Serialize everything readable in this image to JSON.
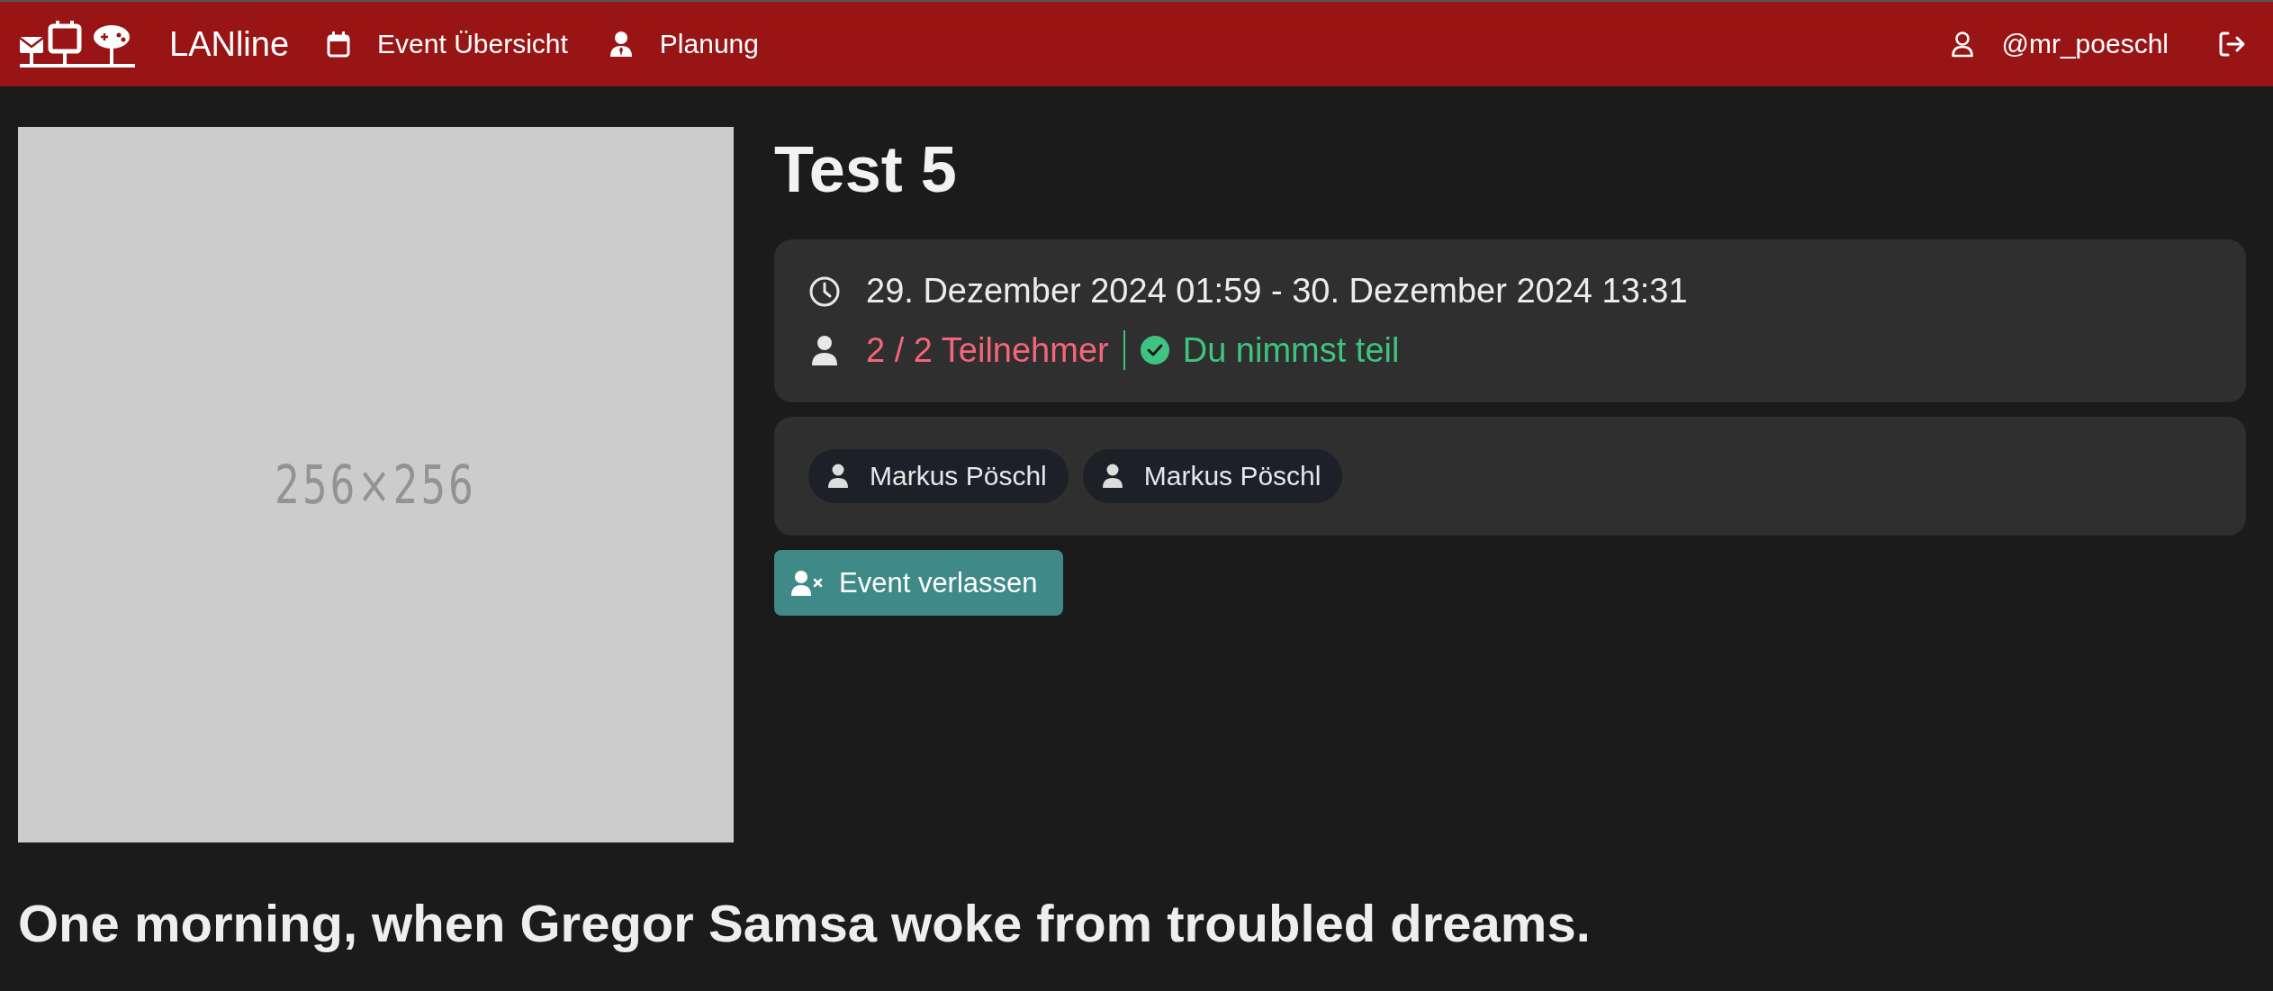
{
  "navbar": {
    "brand": "LANline",
    "links": [
      {
        "label": "Event Übersicht",
        "kind": "calendar"
      },
      {
        "label": "Planung",
        "kind": "person"
      }
    ],
    "user": "@mr_poeschl"
  },
  "event": {
    "image_label": "256×256",
    "title": "Test 5",
    "date": "29. Dezember 2024 01:59 - 30. Dezember 2024 13:31",
    "participants": "2 / 2 Teilnehmer",
    "full": true,
    "joined": true,
    "status": "Du nimmst teil",
    "attendees": [
      {
        "name": "Markus Pöschl"
      },
      {
        "name": "Markus Pöschl"
      }
    ],
    "leave_button": "Event verlassen"
  },
  "description_heading": "One morning, when Gregor Samsa woke from troubled dreams."
}
